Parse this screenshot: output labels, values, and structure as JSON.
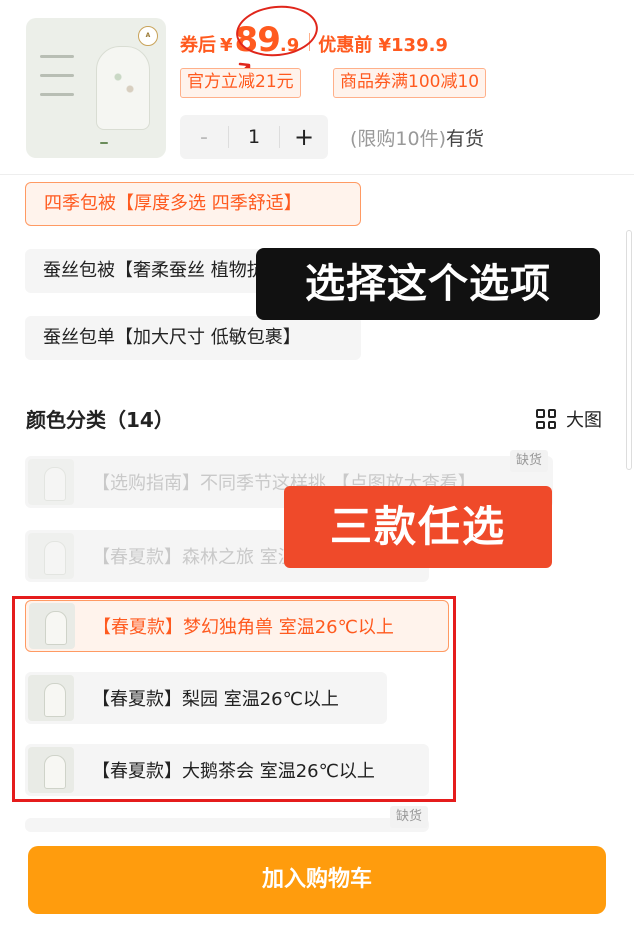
{
  "product": {
    "price_label": "券后",
    "currency": "¥",
    "price_int": "89",
    "price_dec": ".9",
    "original_price_text": "优惠前 ¥139.9",
    "coupons": [
      "官方立减21元",
      "商品券满100减10"
    ],
    "quantity": "1",
    "minus": "-",
    "plus": "+",
    "purchase_limit": "(限购10件)",
    "stock_status": "有货"
  },
  "options": [
    {
      "label": "四季包被【厚度多选 四季舒适】",
      "selected": true
    },
    {
      "label": "蚕丝包被【奢柔蚕丝 植物抗菌】",
      "selected": false
    },
    {
      "label": "蚕丝包单【加大尺寸 低敏包裹】",
      "selected": false
    }
  ],
  "annotations": {
    "black_overlay": "选择这个选项",
    "red_overlay": "三款任选"
  },
  "colors": {
    "title": "颜色分类（14）",
    "big_view_label": "大图",
    "items": [
      {
        "label": "【选购指南】不同季节这样挑 【点图放大查看】",
        "disabled": true
      },
      {
        "label": "【春夏款】森林之旅 室温26℃以上",
        "disabled": true
      },
      {
        "label": "【春夏款】梦幻独角兽 室温26℃以上",
        "selected": true
      },
      {
        "label": "【春夏款】梨园 室温26℃以上"
      },
      {
        "label": "【春夏款】大鹅茶会 室温26℃以上"
      }
    ],
    "out_of_stock": "缺货"
  },
  "footer": {
    "add_to_cart": "加入购物车"
  },
  "theme": {
    "accent": "#ff5a1f",
    "button": "#ff9c0d",
    "highlight_red": "#e51c1c"
  }
}
